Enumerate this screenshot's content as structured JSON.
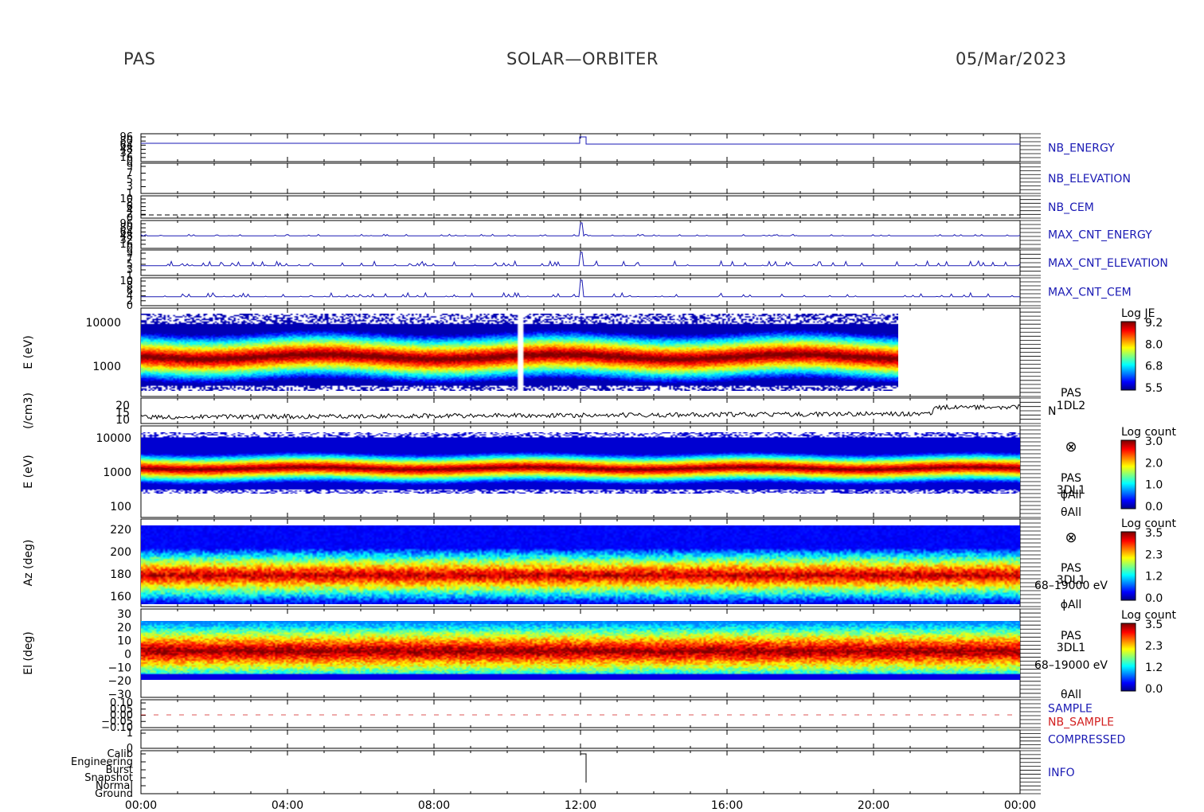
{
  "header": {
    "instrument": "PAS",
    "mission": "SOLAR—ORBITER",
    "date": "05/Mar/2023"
  },
  "colors": {
    "blue_label": "#1a1ab4",
    "red_label": "#d21e1e",
    "axis": "#000000"
  },
  "chart_data": {
    "type": "heatmap",
    "x_tick_labels": [
      "00:00",
      "04:00",
      "08:00",
      "12:00",
      "16:00",
      "20:00",
      "00:00"
    ],
    "panels": [
      {
        "id": "nb_energy",
        "right_label": "NB_ENERGY",
        "left_ticks": [
          "96",
          "80",
          "64",
          "48",
          "32",
          "16",
          "0"
        ]
      },
      {
        "id": "nb_elevation",
        "right_label": "NB_ELEVATION",
        "left_ticks": [
          "9",
          "7",
          "5",
          "3",
          "1"
        ]
      },
      {
        "id": "nb_cem",
        "right_label": "NB_CEM",
        "left_ticks": [
          "10",
          "8",
          "6",
          "4",
          "2",
          "0"
        ]
      },
      {
        "id": "max_cnt_energy",
        "right_label": "MAX_CNT_ENERGY",
        "left_ticks": [
          "96",
          "80",
          "64",
          "48",
          "32",
          "16",
          "0"
        ]
      },
      {
        "id": "max_cnt_elevation",
        "right_label": "MAX_CNT_ELEVATION",
        "left_ticks": [
          "9",
          "7",
          "5",
          "3",
          "1"
        ]
      },
      {
        "id": "max_cnt_cem",
        "right_label": "MAX_CNT_CEM",
        "left_ticks": [
          "10",
          "8",
          "6",
          "4",
          "2",
          "0"
        ]
      },
      {
        "id": "energy_1d",
        "ylabel": "E (eV)",
        "y_ticks": [
          "10000",
          "1000"
        ],
        "label_lines": [
          "PAS",
          "1DL2"
        ],
        "colorbar": {
          "title": "Log JE",
          "ticks": [
            "9.2",
            "8.0",
            "6.8",
            "5.5"
          ]
        }
      },
      {
        "id": "density",
        "ylabel": "(/cm3)",
        "y_ticks": [
          "20",
          "15",
          "10"
        ],
        "right_label": "N"
      },
      {
        "id": "energy_3d",
        "ylabel": "E (eV)",
        "y_ticks": [
          "10000",
          "1000",
          "100"
        ],
        "label_lines": [
          "PAS",
          "3DL1",
          "ϕAll",
          "θAll"
        ],
        "symbol": "⊗",
        "colorbar": {
          "title": "Log count",
          "ticks": [
            "3.0",
            "2.0",
            "1.0",
            "0.0"
          ]
        }
      },
      {
        "id": "azimuth",
        "ylabel": "Az (deg)",
        "y_ticks": [
          "220",
          "200",
          "180",
          "160"
        ],
        "label_lines": [
          "PAS",
          "3DL1",
          "68–19000 eV",
          "ϕAll"
        ],
        "symbol": "⊗",
        "colorbar": {
          "title": "Log count",
          "ticks": [
            "3.5",
            "2.3",
            "1.2",
            "0.0"
          ]
        }
      },
      {
        "id": "elevation",
        "ylabel": "El (deg)",
        "y_ticks": [
          "30",
          "20",
          "10",
          "0",
          "−10",
          "−20",
          "−30"
        ],
        "label_lines": [
          "PAS",
          "3DL1",
          "68–19000 eV",
          "θAll"
        ],
        "colorbar": {
          "title": "Log count",
          "ticks": [
            "3.5",
            "2.3",
            "1.2",
            "0.0"
          ]
        }
      },
      {
        "id": "sample",
        "right_labels": [
          "SAMPLE",
          "NB_SAMPLE"
        ],
        "left_ticks": [
          "0.10",
          "0.05",
          "0.00",
          "−0.05",
          "−0.10"
        ]
      },
      {
        "id": "compressed",
        "right_label": "COMPRESSED",
        "left_ticks": [
          "1",
          "0"
        ]
      },
      {
        "id": "info",
        "right_label": "INFO",
        "left_ticks": [
          "Calib",
          "Engineering",
          "Burst",
          "Snapshot",
          "Normal",
          "Ground"
        ]
      }
    ]
  }
}
